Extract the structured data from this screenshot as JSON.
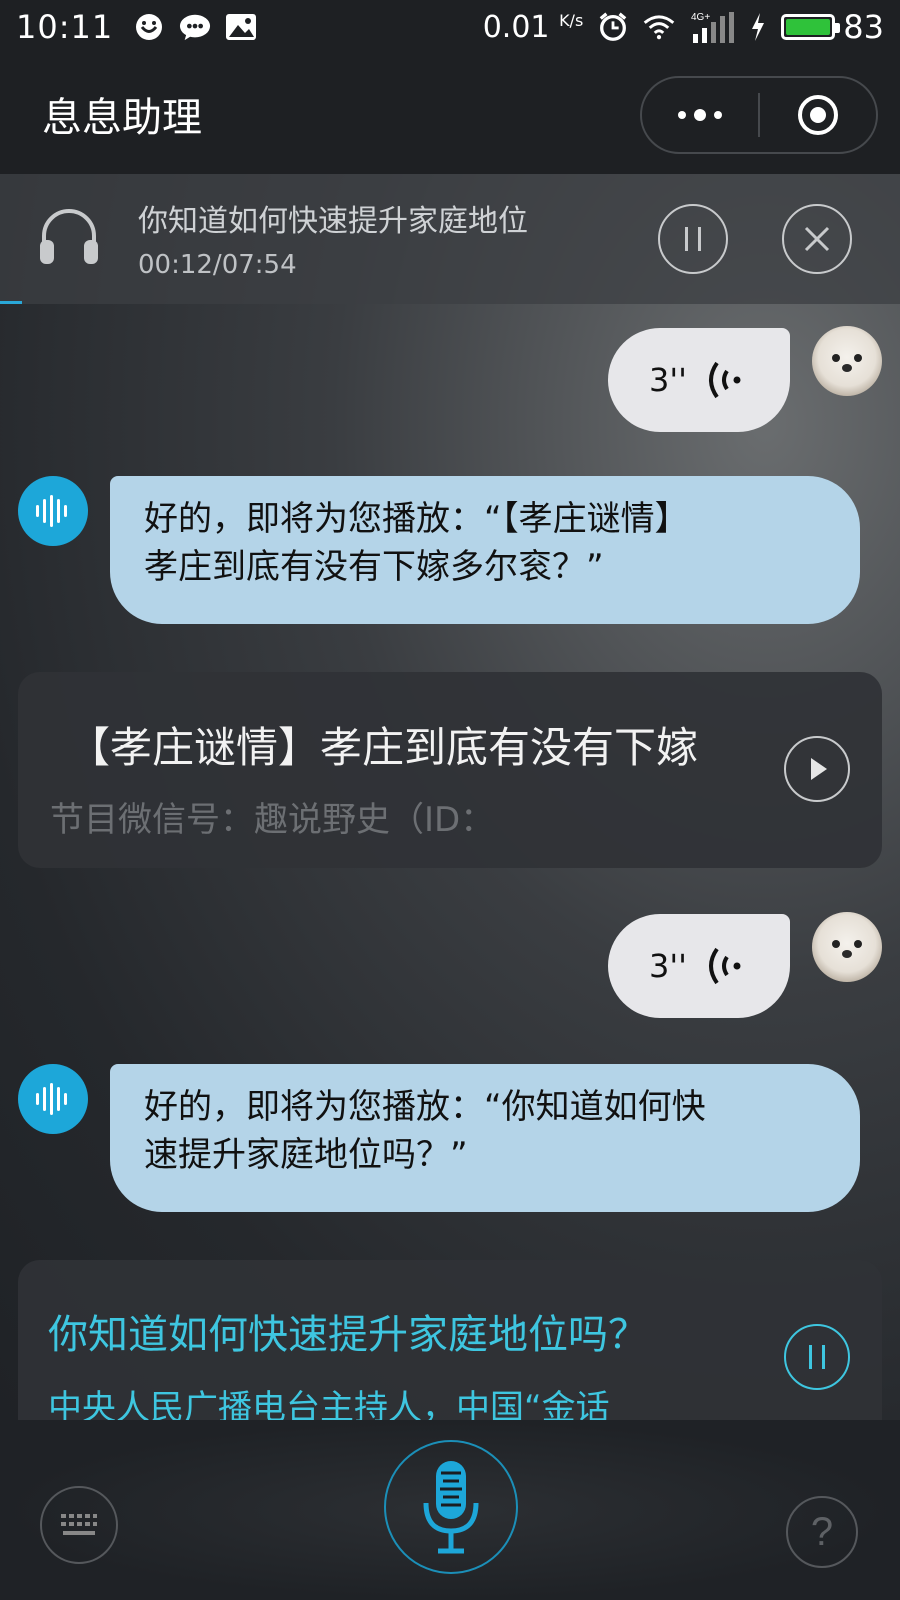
{
  "status_bar": {
    "time": "10:11",
    "net_speed": "0.01",
    "net_unit": "K/s",
    "network": "4G+",
    "battery": "83"
  },
  "title_bar": {
    "title": "息息助理"
  },
  "now_playing": {
    "title": "你知道如何快速提升家庭地位",
    "time": "00:12/07:54"
  },
  "messages": [
    {
      "type": "user_voice",
      "duration": "3''"
    },
    {
      "type": "bot_text",
      "line1": "好的，即将为您播放：“【孝庄谜情】",
      "line2": "孝庄到底有没有下嫁多尔衮？”"
    },
    {
      "type": "card",
      "title": "【孝庄谜情】孝庄到底有没有下嫁",
      "subtitle": "节目微信号：趣说野史（ID："
    },
    {
      "type": "user_voice",
      "duration": "3''"
    },
    {
      "type": "bot_text",
      "line1": "好的，即将为您播放：“你知道如何快",
      "line2": "速提升家庭地位吗？”"
    },
    {
      "type": "card",
      "title": "你知道如何快速提升家庭地位吗？",
      "subtitle": "中央人民广播电台主持人，中国“金话"
    }
  ],
  "colors": {
    "accent": "#1da7d9",
    "active_text": "#3ec6e0",
    "bot_bubble": "#b4d4e8",
    "user_bubble": "#e7e7ea",
    "battery": "#2fc23a"
  },
  "icons": {
    "keyboard": "keyboard-icon",
    "mic": "microphone-icon",
    "help": "help-icon"
  }
}
